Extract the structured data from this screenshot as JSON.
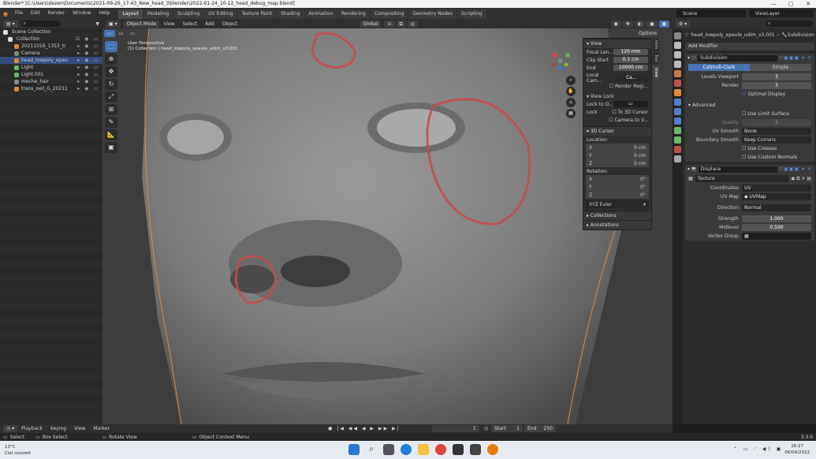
{
  "window": {
    "title": "Blender* [C:\\Users\\dezen\\Documents\\2021-09-26_17-43_New_head_3\\blender\\2022-01-24_10-12_head_debug_map.blend]"
  },
  "menubar": {
    "app_menus": [
      "File",
      "Edit",
      "Render",
      "Window",
      "Help"
    ],
    "workspaces": [
      "Layout",
      "Modeling",
      "Sculpting",
      "UV Editing",
      "Texture Paint",
      "Shading",
      "Animation",
      "Rendering",
      "Compositing",
      "Geometry Nodes",
      "Scripting"
    ],
    "active_workspace": "Layout",
    "scene_label": "Scene",
    "view_layer_label": "ViewLayer"
  },
  "outliner": {
    "root": "Scene Collection",
    "collection": "Collection",
    "items": [
      {
        "name": "20211016_1353_tr",
        "color": "#e08a3c"
      },
      {
        "name": "Camera",
        "color": "#7a8c7a"
      },
      {
        "name": "head_lowpoly_epau",
        "color": "#e08a3c",
        "selected": true
      },
      {
        "name": "Light",
        "color": "#6bb86b"
      },
      {
        "name": "Light.001",
        "color": "#6bb86b"
      },
      {
        "name": "meche_hair",
        "color": "#8a8a8a"
      },
      {
        "name": "trans_oeil_G_20211",
        "color": "#e08a3c"
      }
    ]
  },
  "viewport": {
    "mode": "Object Mode",
    "menus": [
      "View",
      "Select",
      "Add",
      "Object"
    ],
    "orientation": "Global",
    "options": "Options",
    "overlay_line1": "User Perspective",
    "overlay_line2": "(1) Collection | head_lowpoly_epaule_udim_v3.001",
    "tools": [
      "select-tool",
      "cursor-tool",
      "move-tool",
      "rotate-tool",
      "scale-tool",
      "transform-tool",
      "annotate-tool",
      "measure-tool",
      "add-cube-tool"
    ]
  },
  "npanel": {
    "view_header": "View",
    "focal_label": "Focal Len...",
    "focal_value": "120 mm",
    "clip_start_label": "Clip Start",
    "clip_start_value": "0.1 cm",
    "end_label": "End",
    "end_value": "10000 cm",
    "local_cam_label": "Local Cam...",
    "local_cam_value": "Ca...",
    "render_region": "Render Regi...",
    "view_lock": "View Lock",
    "lock_to_label": "Lock to O...",
    "lock_label": "Lock",
    "lock_cursor": "To 3D Cursor",
    "camera_view": "Camera to V...",
    "cursor_header": "3D Cursor",
    "location": "Location:",
    "x": "X",
    "y": "Y",
    "z": "Z",
    "loc_x": "0 cm",
    "loc_y": "0 cm",
    "loc_z": "0 cm",
    "rotation": "Rotation:",
    "rot_x": "0°",
    "rot_y": "0°",
    "rot_z": "0°",
    "rot_mode": "XYZ Euler",
    "collections": "Collections",
    "annotations": "Annotations",
    "tabs": [
      "Item",
      "Tool",
      "View"
    ]
  },
  "properties": {
    "object_name": "head_lowpoly_epaule_udim_v3.001",
    "modifier_context": "Subdivision",
    "add_modifier": "Add Modifier",
    "subdiv": {
      "name": "Subdivision",
      "catmull": "Catmull-Clark",
      "simple": "Simple",
      "levels_label": "Levels Viewport",
      "levels_value": "3",
      "render_label": "Render",
      "render_value": "3",
      "optimal": "Optimal Display",
      "advanced": "Advanced",
      "limit_surface": "Use Limit Surface",
      "quality_label": "Quality",
      "quality_value": "3",
      "uv_smooth_label": "UV Smooth",
      "uv_smooth_value": "None",
      "boundary_label": "Boundary Smooth",
      "boundary_value": "Keep Corners",
      "use_creases": "Use Creases",
      "custom_normals": "Use Custom Normals"
    },
    "displace": {
      "name": "Displace",
      "texture_label": "Texture",
      "coords_label": "Coordinates",
      "coords_value": "UV",
      "uvmap_label": "UV Map",
      "uvmap_value": "UVMap",
      "direction_label": "Direction",
      "direction_value": "Normal",
      "strength_label": "Strength",
      "strength_value": "1.000",
      "midlevel_label": "Midlevel",
      "midlevel_value": "0.500",
      "vgroup_label": "Vertex Group"
    }
  },
  "timeline": {
    "menus": [
      "Playback",
      "Keying",
      "View",
      "Marker"
    ],
    "current_frame": "1",
    "start_label": "Start",
    "start_value": "1",
    "end_label": "End",
    "end_value": "250"
  },
  "statusbar": {
    "select": "Select",
    "box_select": "Box Select",
    "rotate_view": "Rotate View",
    "context_menu": "Object Context Menu",
    "version": "3.3.0"
  },
  "taskbar": {
    "temp": "13°C",
    "weather": "Ciel couvert",
    "time": "16:27",
    "date": "06/04/2022"
  }
}
